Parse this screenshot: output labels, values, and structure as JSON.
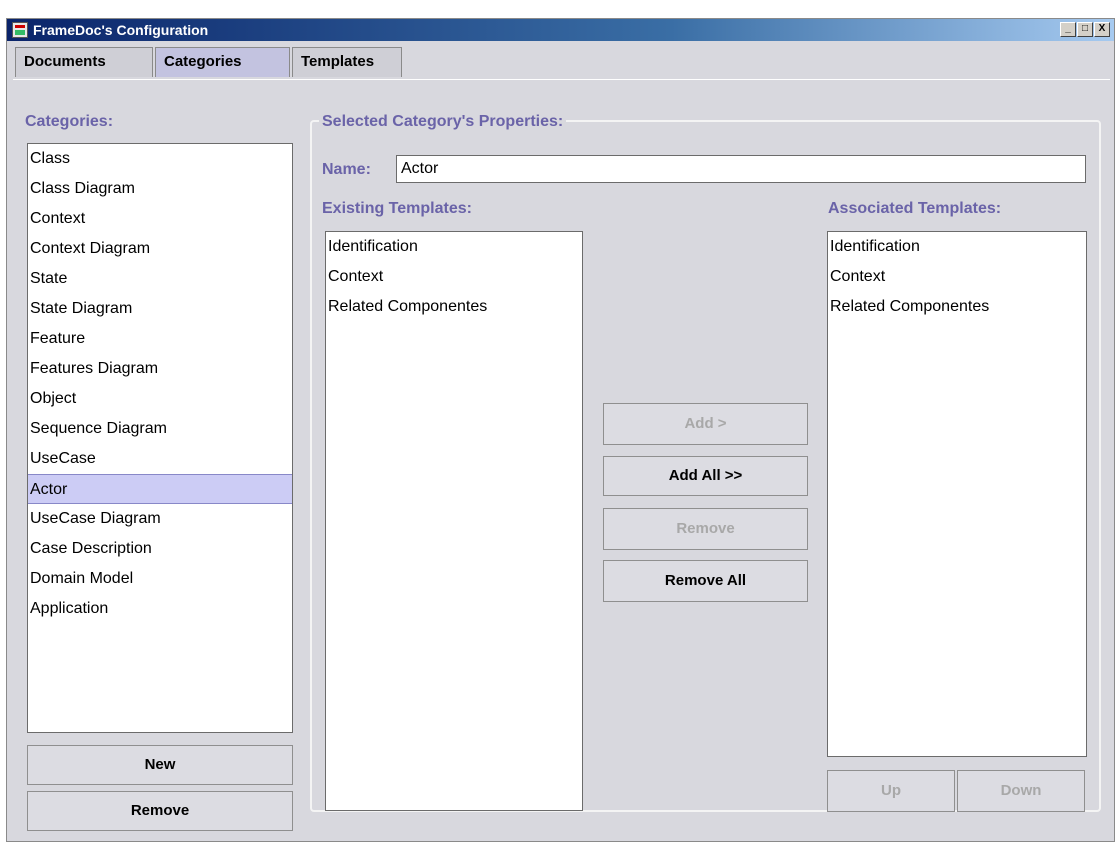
{
  "window": {
    "title": "FrameDoc's Configuration",
    "controls": {
      "minimize": "_",
      "maximize": "□",
      "close": "X"
    }
  },
  "tabs": [
    {
      "label": "Documents",
      "active": false
    },
    {
      "label": "Categories",
      "active": true
    },
    {
      "label": "Templates",
      "active": false
    }
  ],
  "categories": {
    "label": "Categories:",
    "items": [
      "Class",
      "Class Diagram",
      "Context",
      "Context Diagram",
      "State",
      "State Diagram",
      "Feature",
      "Features Diagram",
      "Object",
      "Sequence Diagram",
      "UseCase",
      "Actor",
      "UseCase Diagram",
      "Case Description",
      "Domain Model",
      "Application"
    ],
    "selected": "Actor",
    "new_label": "New",
    "remove_label": "Remove"
  },
  "properties": {
    "group_label": "Selected Category's Properties:",
    "name_label": "Name:",
    "name_value": "Actor",
    "existing_label": "Existing Templates:",
    "existing_items": [
      "Identification",
      "Context",
      "Related Componentes"
    ],
    "associated_label": "Associated Templates:",
    "associated_items": [
      "Identification",
      "Context",
      "Related Componentes"
    ],
    "add_label": "Add >",
    "add_all_label": "Add All >>",
    "remove_label": "Remove",
    "remove_all_label": "Remove All",
    "up_label": "Up",
    "down_label": "Down"
  },
  "colors": {
    "accent_label": "#6a63a8",
    "selection": "#ccccf5",
    "titlebar": "#0a246a"
  }
}
